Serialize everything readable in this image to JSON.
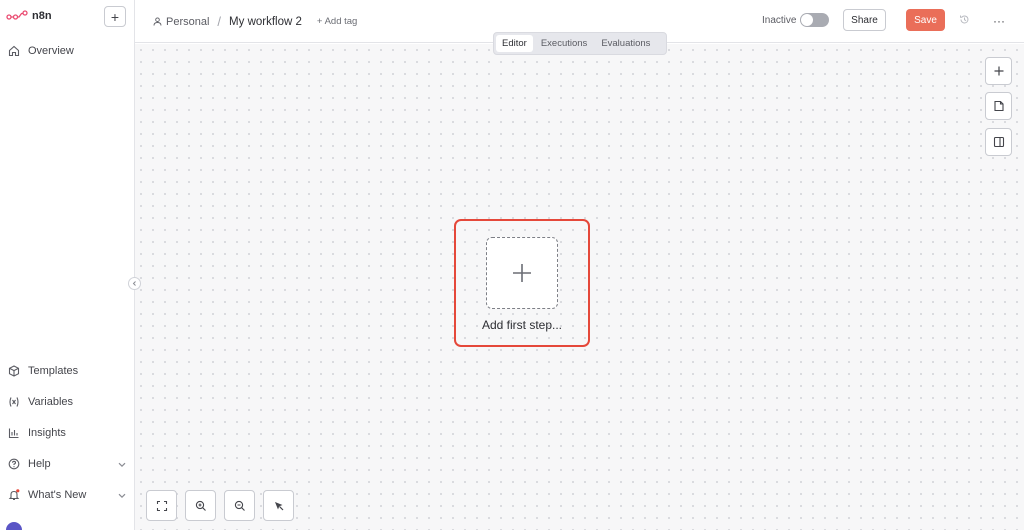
{
  "app": {
    "name": "n8n"
  },
  "sidebar": {
    "new_label": "+",
    "top_items": [
      {
        "label": "Overview",
        "icon": "home-icon"
      }
    ],
    "bottom_items": [
      {
        "label": "Templates",
        "icon": "box-icon"
      },
      {
        "label": "Variables",
        "icon": "variable-icon"
      },
      {
        "label": "Insights",
        "icon": "chart-icon"
      },
      {
        "label": "Help",
        "icon": "help-icon"
      },
      {
        "label": "What's New",
        "icon": "bell-icon"
      }
    ]
  },
  "header": {
    "project": "Personal",
    "separator": "/",
    "workflow_title": "My workflow 2",
    "add_tag": "+ Add tag",
    "status_label": "Inactive",
    "active": false,
    "share_label": "Share",
    "save_label": "Save",
    "more_label": "···"
  },
  "tabs": [
    {
      "label": "Editor",
      "active": true
    },
    {
      "label": "Executions",
      "active": false
    },
    {
      "label": "Evaluations",
      "active": false
    }
  ],
  "canvas": {
    "first_step_label": "Add first step...",
    "side_tools": [
      "plus-icon",
      "sticky-note-icon",
      "panel-icon"
    ],
    "zoom_tools": [
      "fit-view-icon",
      "zoom-in-icon",
      "zoom-out-icon",
      "tidy-up-icon"
    ]
  },
  "colors": {
    "brand": "#ea4b71",
    "save": "#ea6e59",
    "highlight": "#e5483a",
    "notification_dot": "#e5483a"
  }
}
